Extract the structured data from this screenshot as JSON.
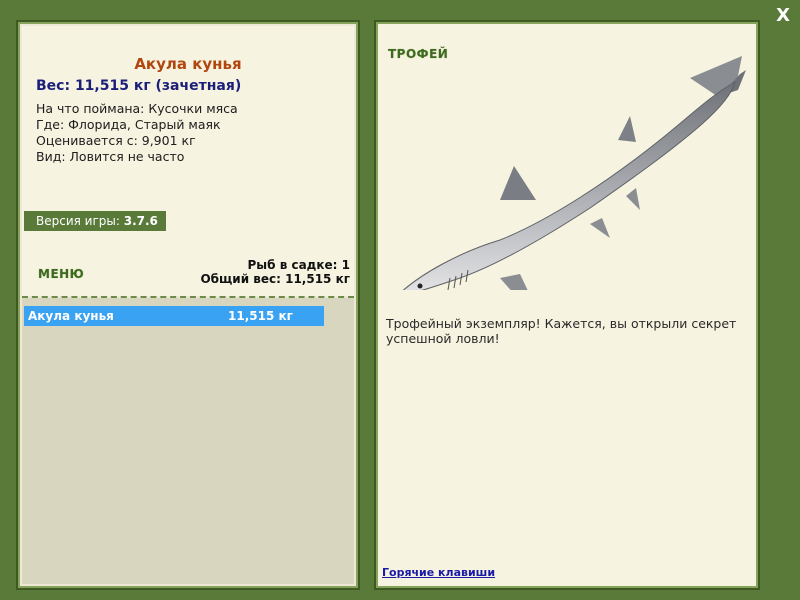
{
  "window": {
    "close_label": "X"
  },
  "fish": {
    "name": "Акула кунья",
    "weight_line": "Вес: 11,515 кг (зачетная)",
    "caught_on": "На что поймана: Кусочки мяса",
    "location": "Где: Флорида, Старый маяк",
    "rated_from": "Оценивается с: 9,901 кг",
    "rarity": "Вид: Ловится не часто"
  },
  "game": {
    "version_label": "Версия игры:",
    "version": "3.7.6"
  },
  "menu": {
    "label": "МЕНЮ"
  },
  "cage": {
    "count_line": "Рыб в садке: 1",
    "total_line": "Общий вес: 11,515 кг",
    "items": [
      {
        "name": "Акула кунья",
        "weight": "11,515 кг"
      }
    ]
  },
  "trophy": {
    "label": "ТРОФЕЙ",
    "image_icon": "shark-icon",
    "text": "Трофейный экземпляр! Кажется, вы открыли секрет успешной ловли!"
  },
  "footer": {
    "hotkeys_link": "Горячие клавиши"
  },
  "colors": {
    "background": "#5a7a3a",
    "title": "#b1470e",
    "weight": "#1c1f7a",
    "selection": "#3aa2f2",
    "menu_text": "#3e6a20"
  }
}
